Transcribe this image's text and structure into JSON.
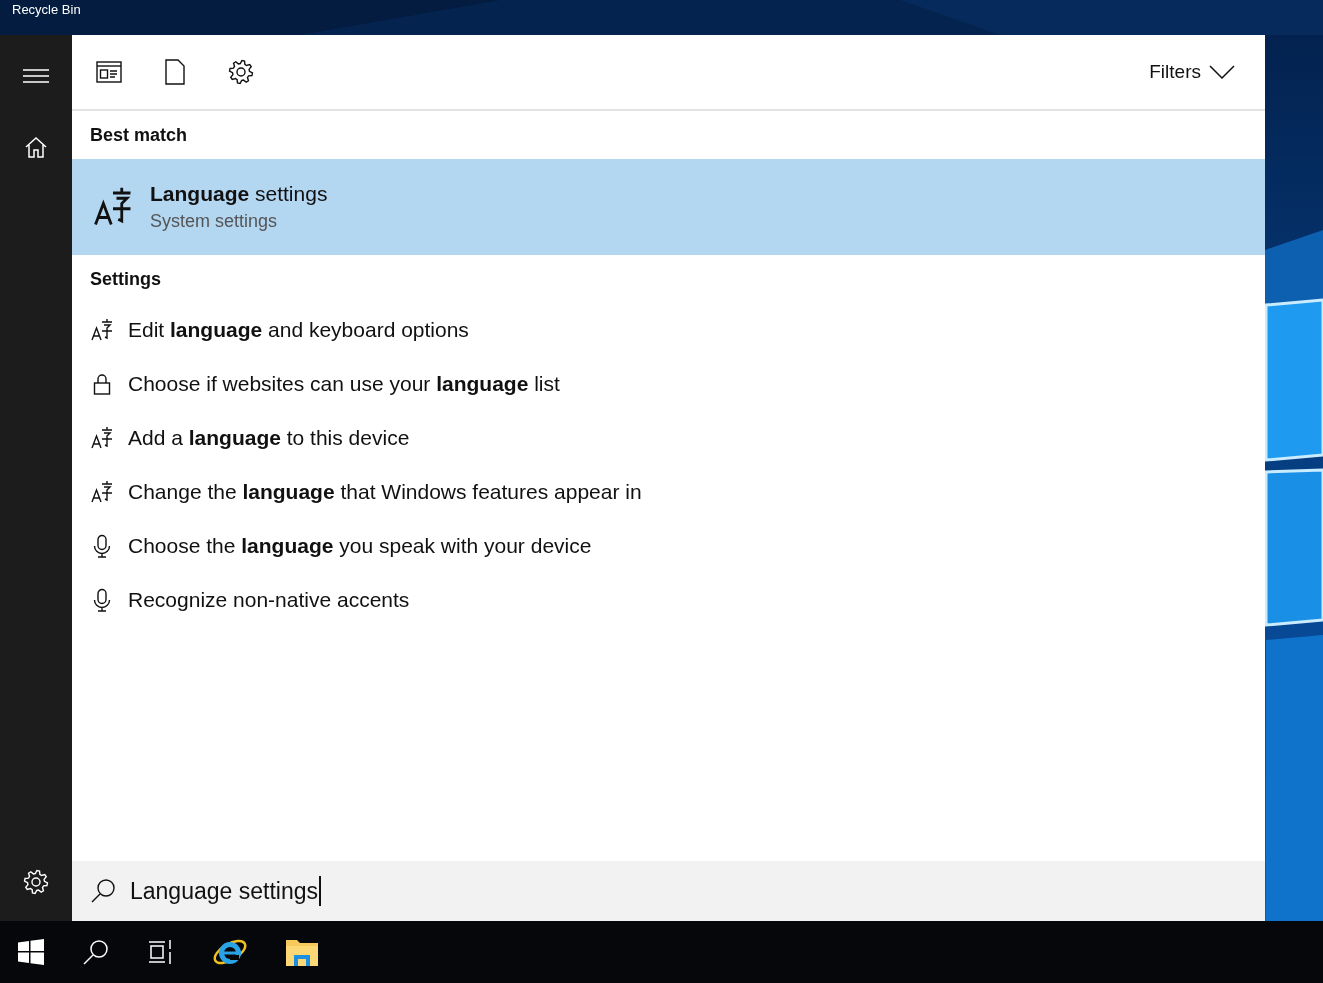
{
  "desktop": {
    "icon_label": "Recycle Bin"
  },
  "toolbar": {
    "filters": "Filters"
  },
  "best_match": {
    "heading": "Best match",
    "title": "**Language** settings",
    "subtitle": "System settings",
    "selected": true
  },
  "settings": {
    "heading": "Settings",
    "items": [
      {
        "kind": "language",
        "text": "Edit **language** and keyboard options"
      },
      {
        "kind": "lock",
        "text": "Choose if websites can use your **language** list"
      },
      {
        "kind": "language",
        "text": "Add a **language** to this device"
      },
      {
        "kind": "language",
        "text": "Change the **language** that Windows features appear in"
      },
      {
        "kind": "microphone",
        "text": "Choose the **language** you speak with your device"
      },
      {
        "kind": "microphone",
        "text": "Recognize non-native accents"
      }
    ]
  },
  "search": {
    "value": "Language settings"
  }
}
